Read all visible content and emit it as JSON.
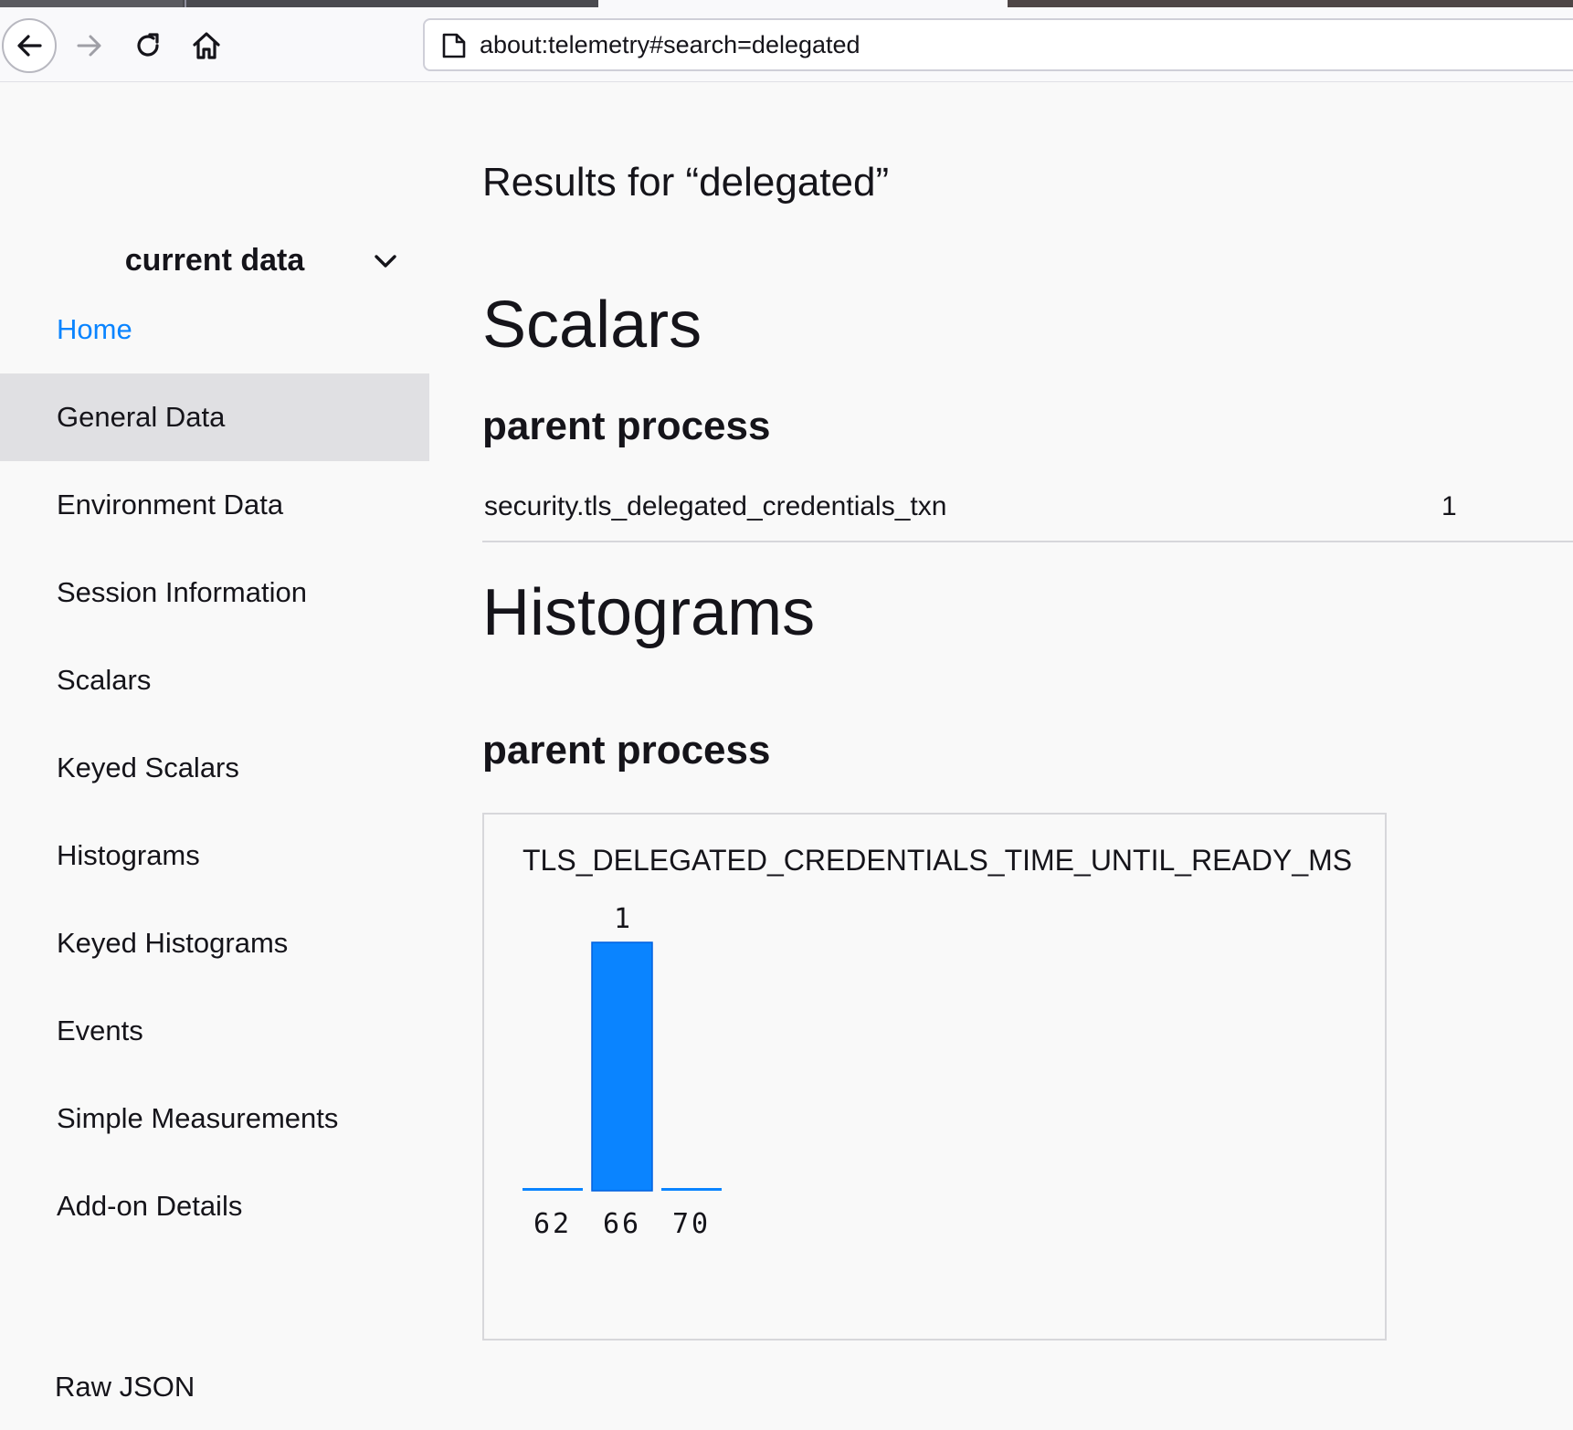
{
  "browser": {
    "url": "about:telemetry#search=delegated"
  },
  "sidebar": {
    "category": "current data",
    "items": [
      {
        "label": "Home"
      },
      {
        "label": "General Data"
      },
      {
        "label": "Environment Data"
      },
      {
        "label": "Session Information"
      },
      {
        "label": "Scalars"
      },
      {
        "label": "Keyed Scalars"
      },
      {
        "label": "Histograms"
      },
      {
        "label": "Keyed Histograms"
      },
      {
        "label": "Events"
      },
      {
        "label": "Simple Measurements"
      },
      {
        "label": "Add-on Details"
      }
    ],
    "raw_json": "Raw JSON"
  },
  "main": {
    "results_title": "Results for “delegated”",
    "scalars": {
      "title": "Scalars",
      "process": "parent process",
      "rows": [
        {
          "key": "security.tls_delegated_credentials_txn",
          "value": "1"
        }
      ]
    },
    "histograms": {
      "title": "Histograms",
      "process": "parent process"
    }
  },
  "colors": {
    "accent": "#0a84ff",
    "bar": "#0a84ff",
    "selected_bg": "#e0e0e3"
  },
  "chart_data": {
    "type": "bar",
    "title": "TLS_DELEGATED_CREDENTIALS_TIME_UNTIL_READY_MS",
    "categories": [
      "62",
      "66",
      "70"
    ],
    "values": [
      0,
      1,
      0
    ],
    "value_labels": [
      "",
      "1",
      ""
    ],
    "ylim": [
      0,
      1
    ]
  }
}
